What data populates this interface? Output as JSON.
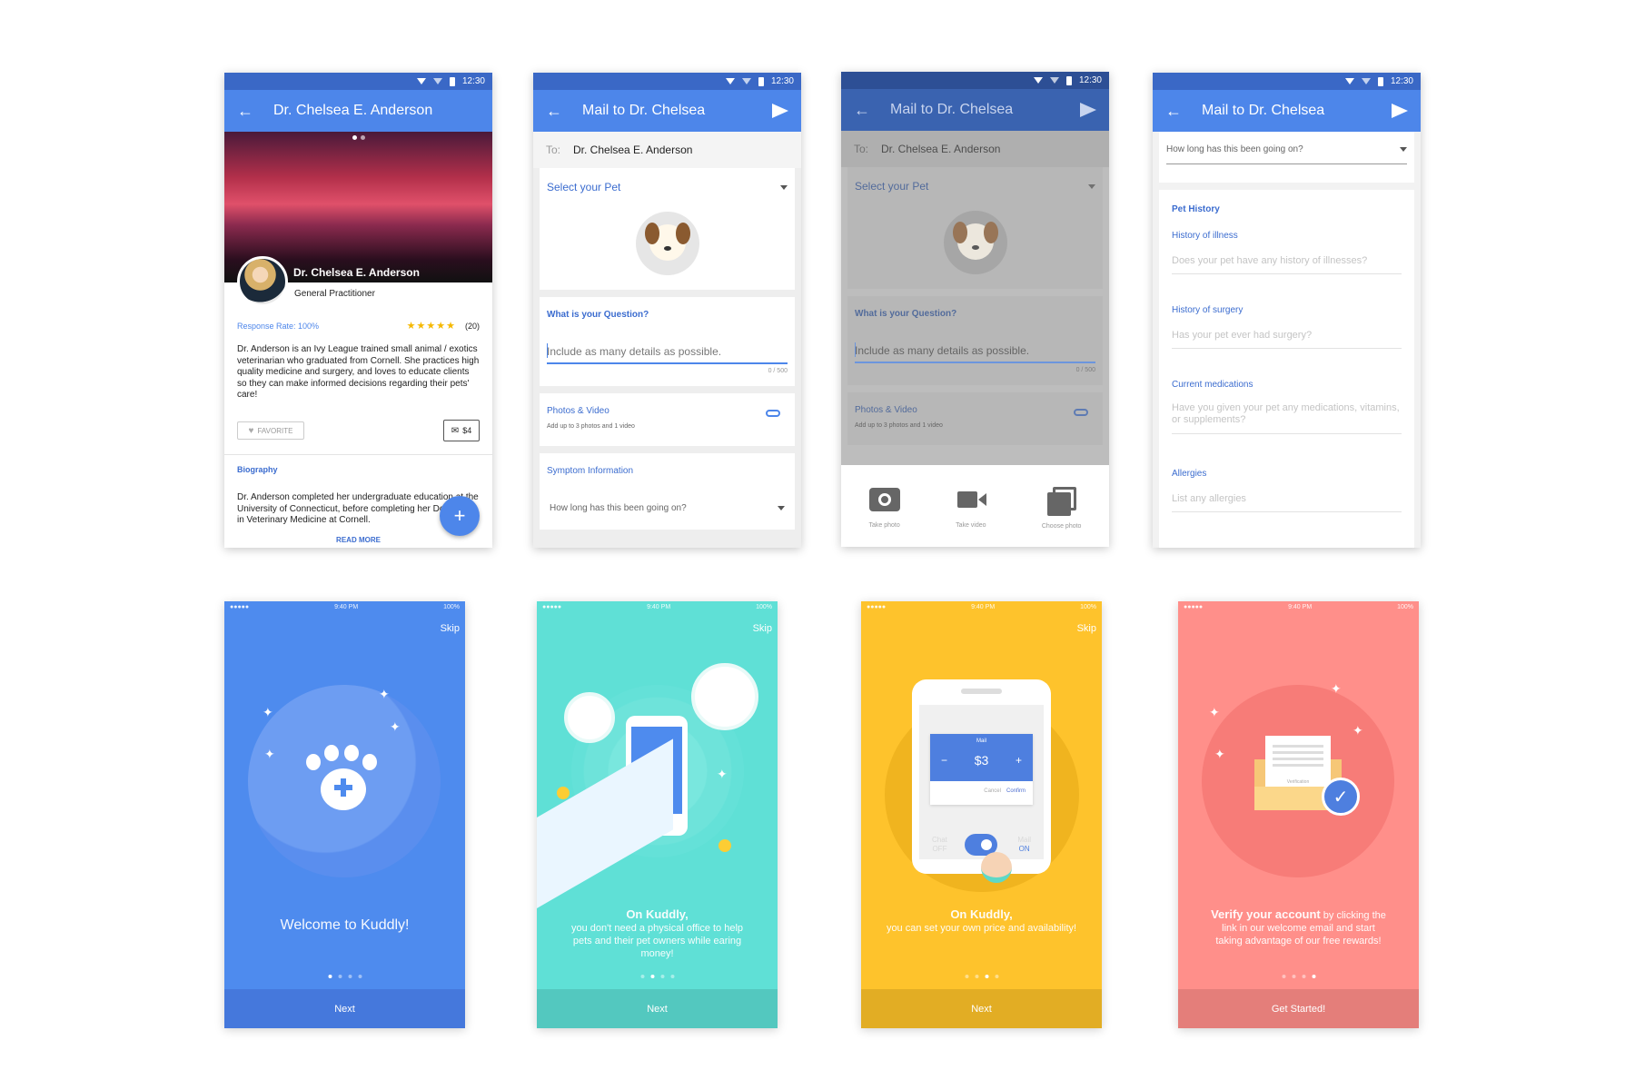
{
  "status": {
    "time": "12:30"
  },
  "profile": {
    "title": "Dr. Chelsea E. Anderson",
    "name": "Dr. Chelsea E. Anderson",
    "role": "General Practitioner",
    "response_rate": "Response Rate: 100%",
    "stars": "★★★★★",
    "review_count": "(20)",
    "rating": 5,
    "bio": "Dr. Anderson is an Ivy League trained small animal / exotics veterinarian who graduated from Cornell. She practices high quality medicine and surgery, and loves to educate clients so they can make informed decisions regarding their pets' care!",
    "favorite_label": "FAVORITE",
    "price_label": "$4",
    "biography_heading": "Biography",
    "biography_text": "Dr. Anderson completed her undergraduate education at the University of Connecticut, before completing her Doctorate in Veterinary Medicine at Cornell.",
    "read_more": "READ MORE",
    "fab": "+"
  },
  "mail": {
    "title": "Mail to Dr. Chelsea",
    "to_label": "To:",
    "to_value": "Dr. Chelsea E. Anderson",
    "select_pet": "Select your Pet",
    "question_label": "What is your Question?",
    "question_placeholder": "Include as many details as possible.",
    "counter": "0 / 500",
    "photos_label": "Photos & Video",
    "photos_hint": "Add up to 3 photos and 1 video",
    "symptom_label": "Symptom Information",
    "duration_placeholder": "How long has this been going on?",
    "actions": [
      "Take photo",
      "Take video",
      "Choose photo"
    ]
  },
  "history": {
    "duration_placeholder": "How long has this been going on?",
    "heading": "Pet History",
    "fields": [
      {
        "label": "History of illness",
        "placeholder": "Does your pet have any history of illnesses?"
      },
      {
        "label": "History of surgery",
        "placeholder": "Has your pet ever had surgery?"
      },
      {
        "label": "Current medications",
        "placeholder": "Have you given your pet any medications, vitamins, or supplements?"
      },
      {
        "label": "Allergies",
        "placeholder": "List any allergies"
      }
    ]
  },
  "onboarding": {
    "ios_time": "9:40 PM",
    "battery": "100%",
    "carrier": "●●●●●",
    "skip": "Skip",
    "next": "Next",
    "get_started": "Get Started!",
    "welcome": "Welcome to Kuddly!",
    "s2_head": "On Kuddly,",
    "s2_body": "you don't need a physical office to help pets and their pet owners while earing money!",
    "s3_head": "On Kuddly,",
    "s3_body": "you can set your own price and availability!",
    "s4_head": "Verify your account",
    "s4_body": " by clicking the link in our welcome email and start taking advantage of our free rewards!",
    "mail_card": {
      "title": "Mail",
      "minus": "−",
      "price": "$3",
      "plus": "+",
      "cancel": "Cancel",
      "confirm": "Confirm"
    },
    "chat": "Chat",
    "off": "OFF",
    "mail": "Mail",
    "on": "ON",
    "verification": "Verification"
  }
}
